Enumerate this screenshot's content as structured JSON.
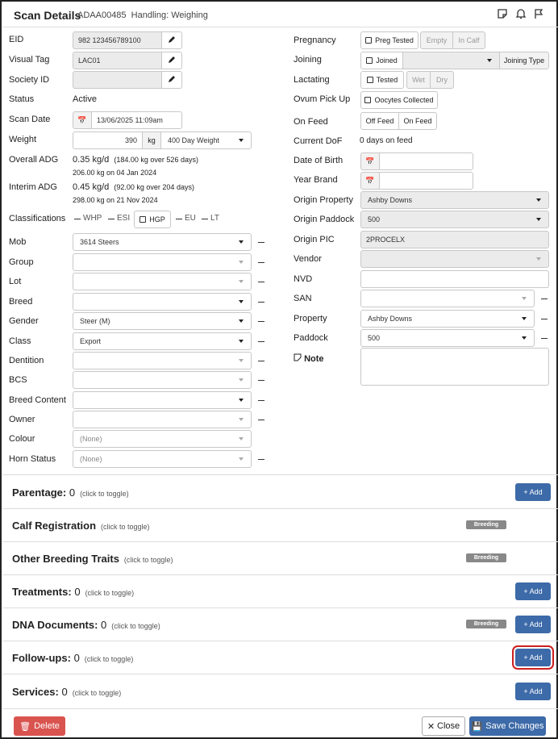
{
  "header": {
    "title": "Scan Details",
    "id": "ADAA00485",
    "handling": "Handling: Weighing"
  },
  "left": {
    "eid": {
      "label": "EID",
      "value": "982 123456789100"
    },
    "visual_tag": {
      "label": "Visual Tag",
      "value": "LAC01"
    },
    "society_id": {
      "label": "Society ID",
      "value": ""
    },
    "status": {
      "label": "Status",
      "value": "Active"
    },
    "scan_date": {
      "label": "Scan Date",
      "value": "13/06/2025 11:09am"
    },
    "weight": {
      "label": "Weight",
      "value": "390",
      "unit": "kg",
      "type": "400 Day Weight"
    },
    "overall_adg": {
      "label": "Overall ADG",
      "value": "0.35 kg/d",
      "detail": "(184.00 kg over 526 days)",
      "line2": "206.00 kg on 04 Jan 2024"
    },
    "interim_adg": {
      "label": "Interim ADG",
      "value": "0.45 kg/d",
      "detail": "(92.00 kg over 204 days)",
      "line2": "298.00 kg on 21 Nov 2024"
    },
    "classifications": {
      "label": "Classifications",
      "whp": "WHP",
      "esi": "ESI",
      "hgp": "HGP",
      "eu": "EU",
      "lt": "LT"
    },
    "mob": {
      "label": "Mob",
      "value": "3614 Steers"
    },
    "group": {
      "label": "Group",
      "value": ""
    },
    "lot": {
      "label": "Lot",
      "value": ""
    },
    "breed": {
      "label": "Breed",
      "value": ""
    },
    "gender": {
      "label": "Gender",
      "value": "Steer (M)"
    },
    "class": {
      "label": "Class",
      "value": "Export"
    },
    "dentition": {
      "label": "Dentition",
      "value": ""
    },
    "bcs": {
      "label": "BCS",
      "value": ""
    },
    "breed_content": {
      "label": "Breed Content",
      "value": ""
    },
    "owner": {
      "label": "Owner",
      "value": ""
    },
    "colour": {
      "label": "Colour",
      "value": "(None)"
    },
    "horn_status": {
      "label": "Horn Status",
      "value": "(None)"
    }
  },
  "right": {
    "pregnancy": {
      "label": "Pregnancy",
      "option": "Preg Tested",
      "empty": "Empty",
      "in_calf": "In Calf"
    },
    "joining": {
      "label": "Joining",
      "option": "Joined",
      "type_btn": "Joining Type"
    },
    "lactating": {
      "label": "Lactating",
      "option": "Tested",
      "wet": "Wet",
      "dry": "Dry"
    },
    "ovum": {
      "label": "Ovum Pick Up",
      "option": "Oocytes Collected"
    },
    "on_feed": {
      "label": "On Feed",
      "off": "Off Feed",
      "on": "On Feed"
    },
    "current_dof": {
      "label": "Current DoF",
      "value": "0 days on feed"
    },
    "dob": {
      "label": "Date of Birth",
      "value": ""
    },
    "year_brand": {
      "label": "Year Brand",
      "value": ""
    },
    "origin_property": {
      "label": "Origin Property",
      "value": "Ashby Downs"
    },
    "origin_paddock": {
      "label": "Origin Paddock",
      "value": "500"
    },
    "origin_pic": {
      "label": "Origin PIC",
      "value": "2PROCELX"
    },
    "vendor": {
      "label": "Vendor",
      "value": ""
    },
    "nvd": {
      "label": "NVD",
      "value": ""
    },
    "san": {
      "label": "SAN",
      "value": ""
    },
    "property": {
      "label": "Property",
      "value": "Ashby Downs"
    },
    "paddock": {
      "label": "Paddock",
      "value": "500"
    },
    "note": {
      "label": "Note",
      "value": ""
    }
  },
  "sections": {
    "toggle_hint": "(click to toggle)",
    "add_label": "+ Add",
    "breeding_badge": "Breeding",
    "parentage": {
      "label": "Parentage:",
      "count": "0"
    },
    "calf_registration": {
      "label": "Calf Registration"
    },
    "other_breeding": {
      "label": "Other Breeding Traits"
    },
    "treatments": {
      "label": "Treatments:",
      "count": "0"
    },
    "dna": {
      "label": "DNA Documents:",
      "count": "0"
    },
    "followups": {
      "label": "Follow-ups:",
      "count": "0"
    },
    "services": {
      "label": "Services:",
      "count": "0"
    }
  },
  "footer": {
    "delete": "Delete",
    "close": "Close",
    "save": "Save Changes"
  },
  "colors": {
    "primary": "#3d6aa8",
    "danger": "#d9534f",
    "highlight": "#cc1f1f",
    "breeding": "#888888"
  }
}
